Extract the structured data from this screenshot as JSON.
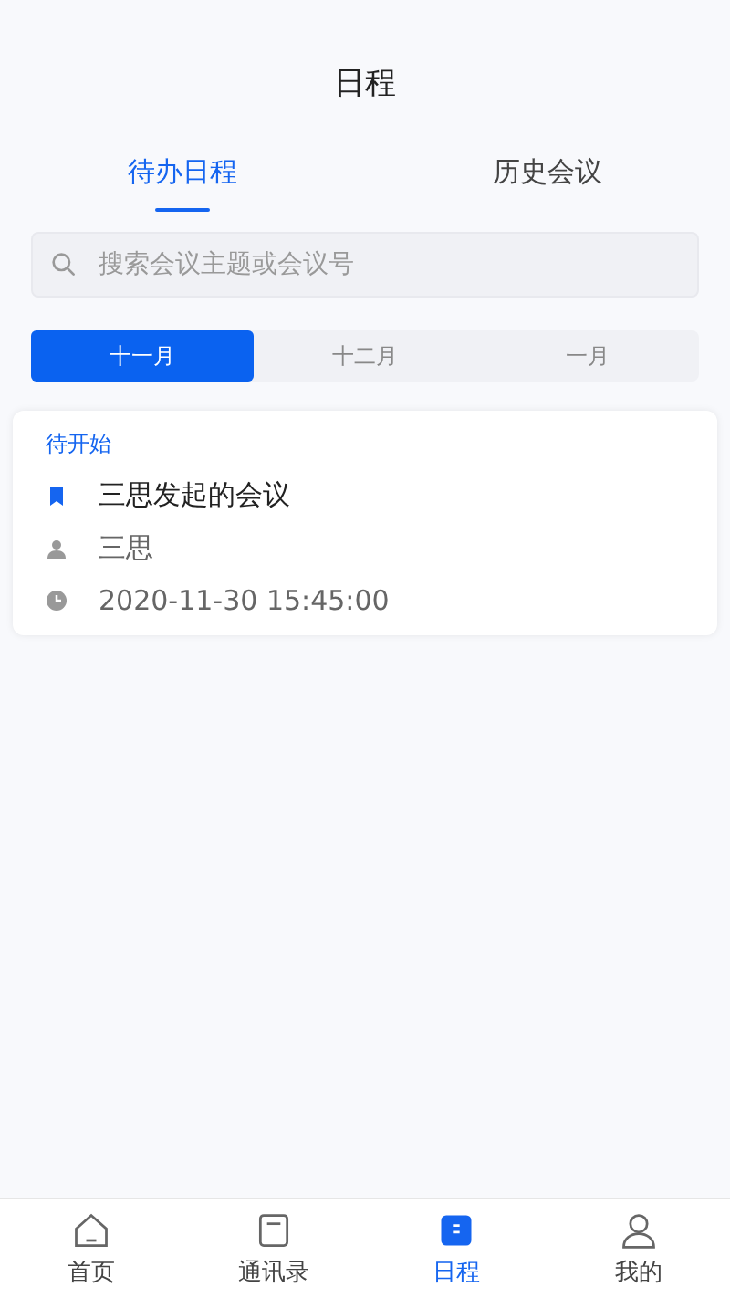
{
  "header": {
    "title": "日程"
  },
  "tabs": [
    {
      "label": "待办日程",
      "selected": true
    },
    {
      "label": "历史会议",
      "selected": false
    }
  ],
  "search": {
    "placeholder": "搜索会议主题或会议号"
  },
  "months": [
    {
      "label": "十一月",
      "selected": true
    },
    {
      "label": "十二月",
      "selected": false
    },
    {
      "label": "一月",
      "selected": false
    }
  ],
  "meetings": [
    {
      "status": "待开始",
      "title": "三思发起的会议",
      "host": "三思",
      "time": "2020-11-30 15:45:00"
    }
  ],
  "nav": [
    {
      "label": "首页",
      "kind": "home",
      "selected": false
    },
    {
      "label": "通讯录",
      "kind": "contacts",
      "selected": false
    },
    {
      "label": "日程",
      "kind": "calendar",
      "selected": true
    },
    {
      "label": "我的",
      "kind": "me",
      "selected": false
    }
  ]
}
